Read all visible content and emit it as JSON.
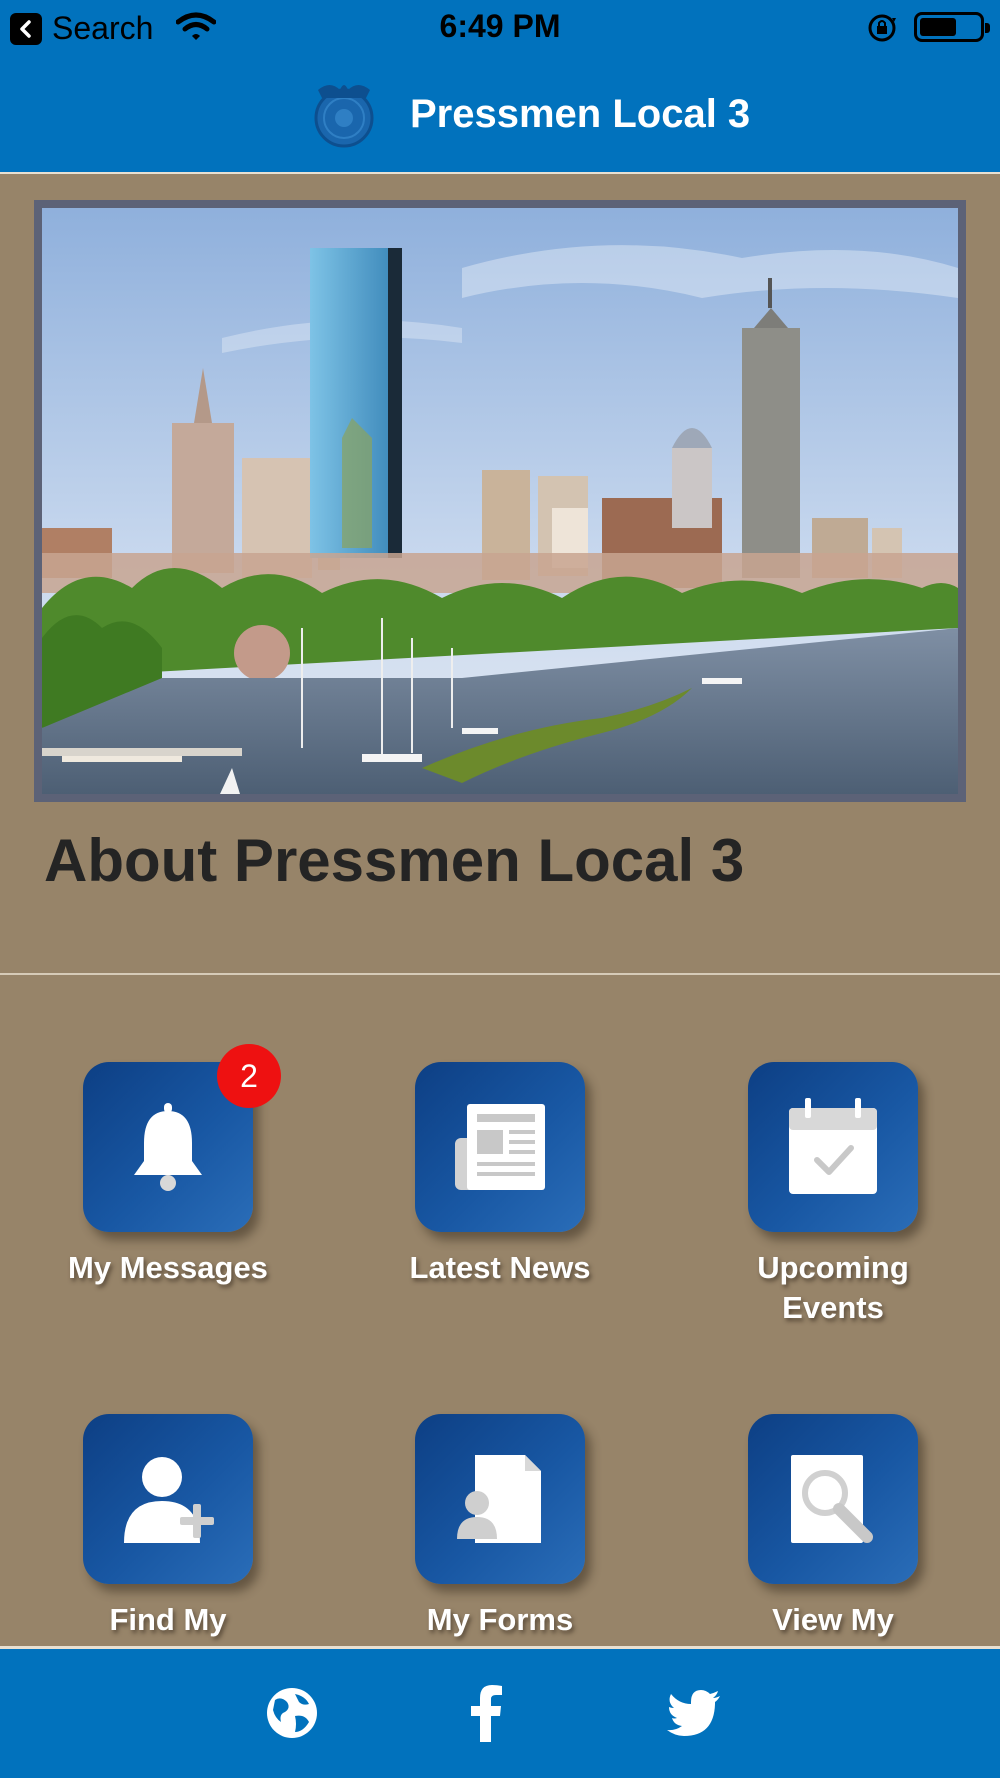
{
  "status_bar": {
    "back_app_label": "Search",
    "time": "6:49 PM"
  },
  "header": {
    "title": "Pressmen Local 3"
  },
  "about": {
    "title": "About Pressmen Local 3"
  },
  "tiles": [
    {
      "label": "My Messages",
      "icon": "bell-icon",
      "badge": "2"
    },
    {
      "label": "Latest News",
      "icon": "newspaper-icon"
    },
    {
      "label_line1": "Upcoming",
      "label_line2": "Events",
      "icon": "calendar-check-icon"
    },
    {
      "label": "Find My",
      "icon": "add-person-icon"
    },
    {
      "label": "My Forms",
      "icon": "person-document-icon"
    },
    {
      "label": "View My",
      "icon": "search-document-icon"
    }
  ],
  "footer": {
    "icons": [
      "globe-icon",
      "facebook-icon",
      "twitter-icon"
    ]
  },
  "colors": {
    "header_blue": "#0172bd",
    "background": "#978469",
    "tile_blue": "#1857a3",
    "badge_red": "#ee1111"
  }
}
